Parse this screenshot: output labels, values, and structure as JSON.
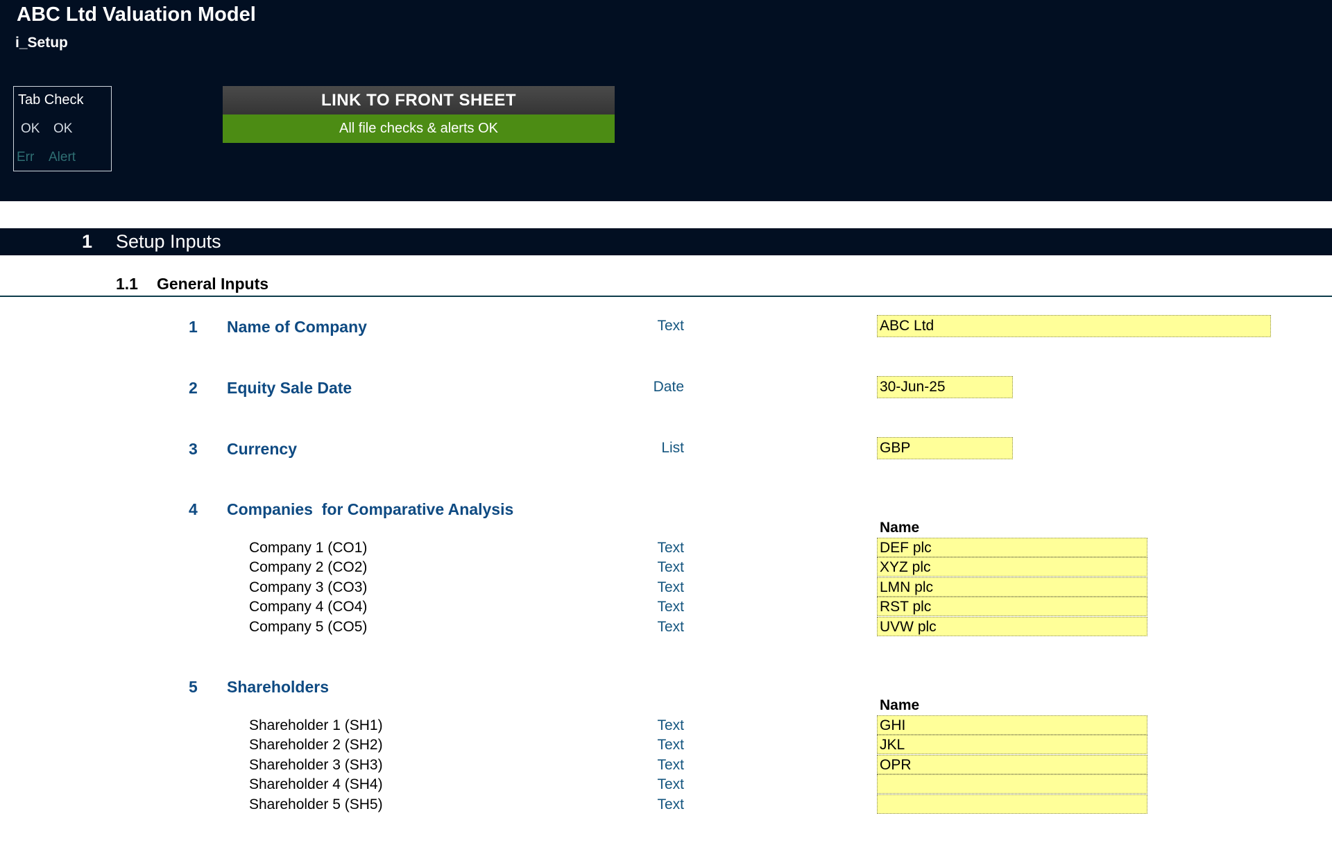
{
  "header": {
    "app_title": "ABC Ltd Valuation Model",
    "sheet_name": "i_Setup",
    "tab_check": {
      "title": "Tab Check",
      "ok_1": "OK",
      "ok_2": "OK",
      "err": "Err",
      "alert": "Alert"
    },
    "link_button": "LINK TO FRONT SHEET",
    "status_text": "All file checks & alerts OK"
  },
  "section": {
    "number": "1",
    "title": "Setup Inputs"
  },
  "subsection": {
    "number": "1.1",
    "title": "General Inputs"
  },
  "items": {
    "company_name": {
      "num": "1",
      "label": "Name of Company",
      "type": "Text",
      "value": "ABC Ltd"
    },
    "sale_date": {
      "num": "2",
      "label": "Equity Sale Date",
      "type": "Date",
      "value": "30-Jun-25"
    },
    "currency": {
      "num": "3",
      "label": "Currency",
      "type": "List",
      "value": "GBP"
    },
    "comparatives": {
      "num": "4",
      "label": "Companies  for Comparative Analysis",
      "col_header": "Name",
      "rows": [
        {
          "label": "Company 1 (CO1)",
          "type": "Text",
          "value": "DEF plc"
        },
        {
          "label": "Company 2 (CO2)",
          "type": "Text",
          "value": "XYZ plc"
        },
        {
          "label": "Company 3 (CO3)",
          "type": "Text",
          "value": "LMN plc"
        },
        {
          "label": "Company 4 (CO4)",
          "type": "Text",
          "value": "RST plc"
        },
        {
          "label": "Company 5 (CO5)",
          "type": "Text",
          "value": "UVW plc"
        }
      ]
    },
    "shareholders": {
      "num": "5",
      "label": "Shareholders",
      "col_header": "Name",
      "rows": [
        {
          "label": "Shareholder 1 (SH1)",
          "type": "Text",
          "value": "GHI"
        },
        {
          "label": "Shareholder 2 (SH2)",
          "type": "Text",
          "value": "JKL"
        },
        {
          "label": "Shareholder 3 (SH3)",
          "type": "Text",
          "value": "OPR"
        },
        {
          "label": "Shareholder 4 (SH4)",
          "type": "Text",
          "value": ""
        },
        {
          "label": "Shareholder 5 (SH5)",
          "type": "Text",
          "value": ""
        }
      ]
    }
  },
  "colors": {
    "header_bg": "#020f22",
    "label_blue": "#0e4a82",
    "input_yellow": "#ffff99",
    "status_green": "#4c8c14"
  }
}
